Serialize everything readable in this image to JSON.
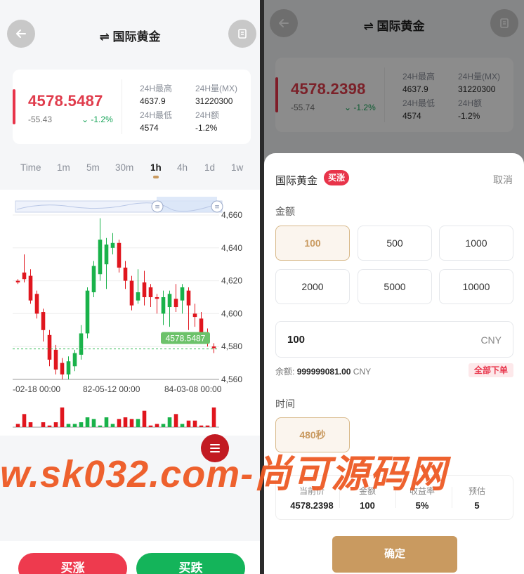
{
  "left": {
    "header": {
      "title": "国际黄金",
      "back_icon": "arrow-left-icon",
      "orders_icon": "document-icon"
    },
    "stats": {
      "price": "4578.5487",
      "change_abs": "-55.43",
      "change_pct": "-1.2%",
      "high_label": "24H最高",
      "high_value": "4637.9",
      "volume_label": "24H量(MX)",
      "volume_value": "31220300",
      "low_label": "24H最低",
      "low_value": "4574",
      "amount_label": "24H额",
      "amount_value": "-1.2%"
    },
    "tabs": [
      "Time",
      "1m",
      "5m",
      "30m",
      "1h",
      "4h",
      "1d",
      "1w"
    ],
    "active_tab": "1h",
    "buy_up_label": "买涨",
    "buy_down_label": "买跌"
  },
  "right": {
    "header": {
      "title": "国际黄金"
    },
    "stats": {
      "price": "4578.2398",
      "change_abs": "-55.74",
      "change_pct": "-1.2%",
      "high_label": "24H最高",
      "high_value": "4637.9",
      "volume_label": "24H量(MX)",
      "volume_value": "31220300",
      "low_label": "24H最低",
      "low_value": "4574",
      "amount_label": "24H额",
      "amount_value": "-1.2%"
    },
    "sheet": {
      "title": "国际黄金",
      "badge": "买涨",
      "cancel": "取消",
      "amount_label": "金额",
      "amount_options": [
        "100",
        "500",
        "1000",
        "2000",
        "5000",
        "10000"
      ],
      "selected_amount": "100",
      "input_value": "100",
      "currency": "CNY",
      "balance_label": "余额:",
      "balance_value": "999999081.00",
      "balance_currency": "CNY",
      "all_order": "全部下单",
      "time_label": "时间",
      "time_option": "480秒",
      "summary": [
        {
          "label": "当前价",
          "value": "4578.2398"
        },
        {
          "label": "金额",
          "value": "100"
        },
        {
          "label": "收益率",
          "value": "5%"
        },
        {
          "label": "预估",
          "value": "5"
        }
      ],
      "confirm": "确定"
    }
  },
  "watermark": "w.sk032.com-尚可源码网",
  "colors": {
    "up": "#19b24a",
    "down": "#e0161e",
    "accent": "#c99a60",
    "price_red": "#e03c4c"
  },
  "chart_data": {
    "type": "candlestick",
    "timeframe": "1h",
    "y_ticks": [
      "4,660",
      "4,640",
      "4,620",
      "4,600",
      "4,580",
      "4,560"
    ],
    "ylim": [
      4560,
      4660
    ],
    "x_ticks": [
      "-02-18 00:00",
      "82-05-12 00:00",
      "84-03-08 00:00"
    ],
    "last_price_label": "4578.5487",
    "last_price": 4578.5487,
    "candles": [
      {
        "o": 4620,
        "c": 4619,
        "h": 4621,
        "l": 4618
      },
      {
        "o": 4625,
        "c": 4621,
        "h": 4636,
        "l": 4619
      },
      {
        "o": 4623,
        "c": 4608,
        "h": 4627,
        "l": 4606
      },
      {
        "o": 4612,
        "c": 4600,
        "h": 4614,
        "l": 4597
      },
      {
        "o": 4601,
        "c": 4590,
        "h": 4603,
        "l": 4583
      },
      {
        "o": 4587,
        "c": 4572,
        "h": 4590,
        "l": 4568
      },
      {
        "o": 4578,
        "c": 4566,
        "h": 4581,
        "l": 4563
      },
      {
        "o": 4570,
        "c": 4563,
        "h": 4573,
        "l": 4560
      },
      {
        "o": 4563,
        "c": 4571,
        "h": 4574,
        "l": 4560
      },
      {
        "o": 4568,
        "c": 4576,
        "h": 4578,
        "l": 4565
      },
      {
        "o": 4575,
        "c": 4588,
        "h": 4593,
        "l": 4572
      },
      {
        "o": 4588,
        "c": 4614,
        "h": 4616,
        "l": 4585
      },
      {
        "o": 4613,
        "c": 4629,
        "h": 4632,
        "l": 4610
      },
      {
        "o": 4624,
        "c": 4645,
        "h": 4658,
        "l": 4620
      },
      {
        "o": 4630,
        "c": 4642,
        "h": 4646,
        "l": 4615
      },
      {
        "o": 4640,
        "c": 4643,
        "h": 4649,
        "l": 4636
      },
      {
        "o": 4643,
        "c": 4628,
        "h": 4645,
        "l": 4625
      },
      {
        "o": 4628,
        "c": 4620,
        "h": 4632,
        "l": 4615
      },
      {
        "o": 4620,
        "c": 4605,
        "h": 4623,
        "l": 4602
      },
      {
        "o": 4608,
        "c": 4613,
        "h": 4627,
        "l": 4606
      },
      {
        "o": 4619,
        "c": 4610,
        "h": 4626,
        "l": 4605
      },
      {
        "o": 4616,
        "c": 4610,
        "h": 4618,
        "l": 4604
      },
      {
        "o": 4610,
        "c": 4609,
        "h": 4612,
        "l": 4600
      },
      {
        "o": 4600,
        "c": 4610,
        "h": 4614,
        "l": 4593
      },
      {
        "o": 4604,
        "c": 4612,
        "h": 4614,
        "l": 4592
      },
      {
        "o": 4609,
        "c": 4604,
        "h": 4618,
        "l": 4601
      },
      {
        "o": 4608,
        "c": 4616,
        "h": 4618,
        "l": 4600
      },
      {
        "o": 4614,
        "c": 4605,
        "h": 4616,
        "l": 4590
      },
      {
        "o": 4600,
        "c": 4598,
        "h": 4606,
        "l": 4592
      },
      {
        "o": 4597,
        "c": 4587,
        "h": 4601,
        "l": 4584
      },
      {
        "o": 4586,
        "c": 4582,
        "h": 4591,
        "l": 4580
      },
      {
        "o": 4580,
        "c": 4579,
        "h": 4582,
        "l": 4576
      }
    ],
    "volumes": [
      2,
      8,
      3,
      0,
      3,
      1,
      3,
      12,
      2,
      2,
      3,
      6,
      5,
      1,
      6,
      2,
      5,
      6,
      5,
      5,
      10,
      1,
      2,
      2,
      6,
      8,
      2,
      4,
      4,
      1,
      1,
      12
    ]
  }
}
